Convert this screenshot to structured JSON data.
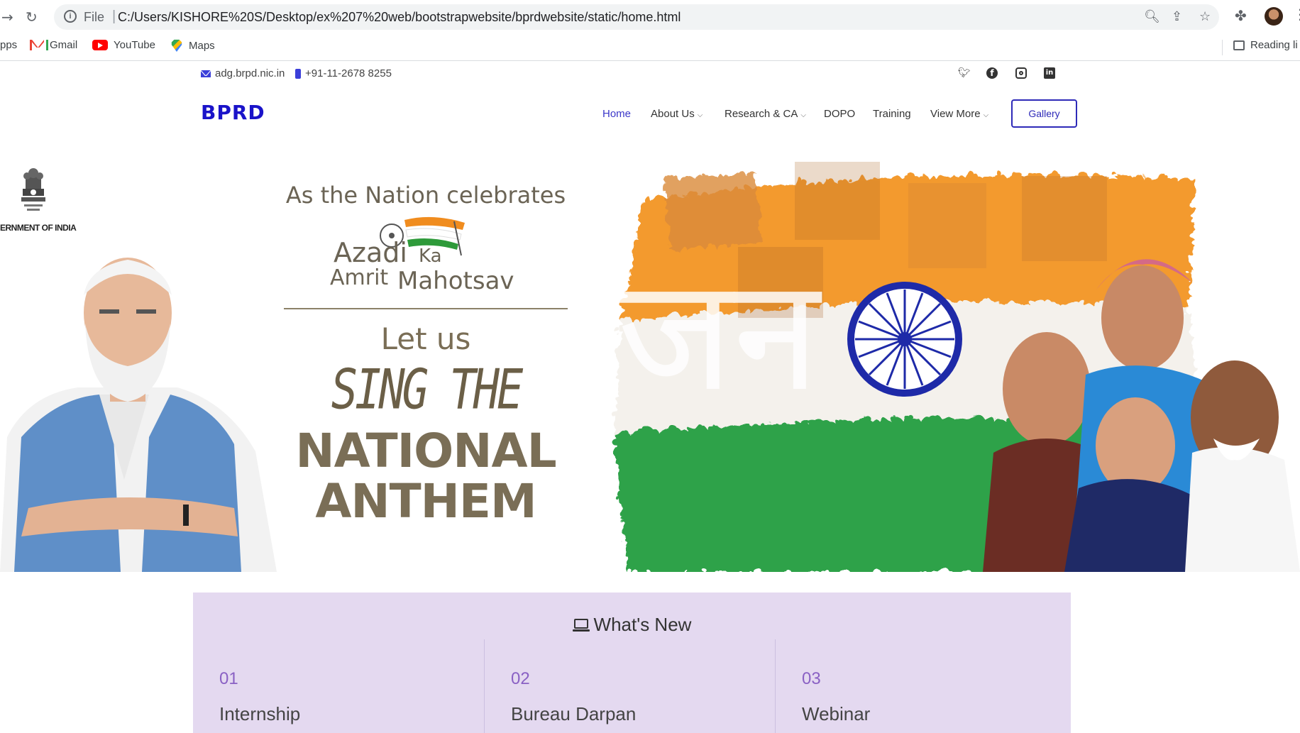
{
  "browser": {
    "url_scheme": "File",
    "url": "C:/Users/KISHORE%20S/Desktop/ex%207%20web/bootstrapwebsite/bprdwebsite/static/home.html",
    "bookmarks": [
      {
        "label": "pps",
        "icon": "apps-icon"
      },
      {
        "label": "Gmail",
        "icon": "gmail-icon"
      },
      {
        "label": "YouTube",
        "icon": "youtube-icon"
      },
      {
        "label": "Maps",
        "icon": "maps-icon"
      }
    ],
    "reading_list": "Reading li"
  },
  "topbar": {
    "email": "adg.brpd.nic.in",
    "phone": "+91-11-2678 8255",
    "social": [
      "twitter-icon",
      "facebook-icon",
      "instagram-icon",
      "linkedin-icon"
    ]
  },
  "header": {
    "logo": "BPRD",
    "nav": [
      {
        "label": "Home",
        "active": true,
        "dropdown": false
      },
      {
        "label": "About Us",
        "active": false,
        "dropdown": true
      },
      {
        "label": "Research & CA",
        "active": false,
        "dropdown": true
      },
      {
        "label": "DOPO",
        "active": false,
        "dropdown": false
      },
      {
        "label": "Training",
        "active": false,
        "dropdown": false
      },
      {
        "label": "View More",
        "active": false,
        "dropdown": true
      }
    ],
    "gallery_label": "Gallery"
  },
  "hero": {
    "emblem_text": "ERNMENT OF INDIA",
    "line1": "As the Nation celebrates",
    "azadi": "Azadi",
    "ka": "Ka",
    "amrit": "Amrit",
    "mahotsav": "Mahotsav",
    "let_us": "Let us",
    "sing_the": "SING THE",
    "national": "NATIONAL",
    "anthem": "ANTHEM"
  },
  "whats_new": {
    "title": "What's New",
    "items": [
      {
        "num": "01",
        "label": "Internship"
      },
      {
        "num": "02",
        "label": "Bureau Darpan"
      },
      {
        "num": "03",
        "label": "Webinar"
      }
    ]
  },
  "colors": {
    "brand": "#1a13c9",
    "nav_active": "#3b37c9",
    "whats_new_bg": "#e4d9f0",
    "whats_new_num": "#8a61c4"
  }
}
